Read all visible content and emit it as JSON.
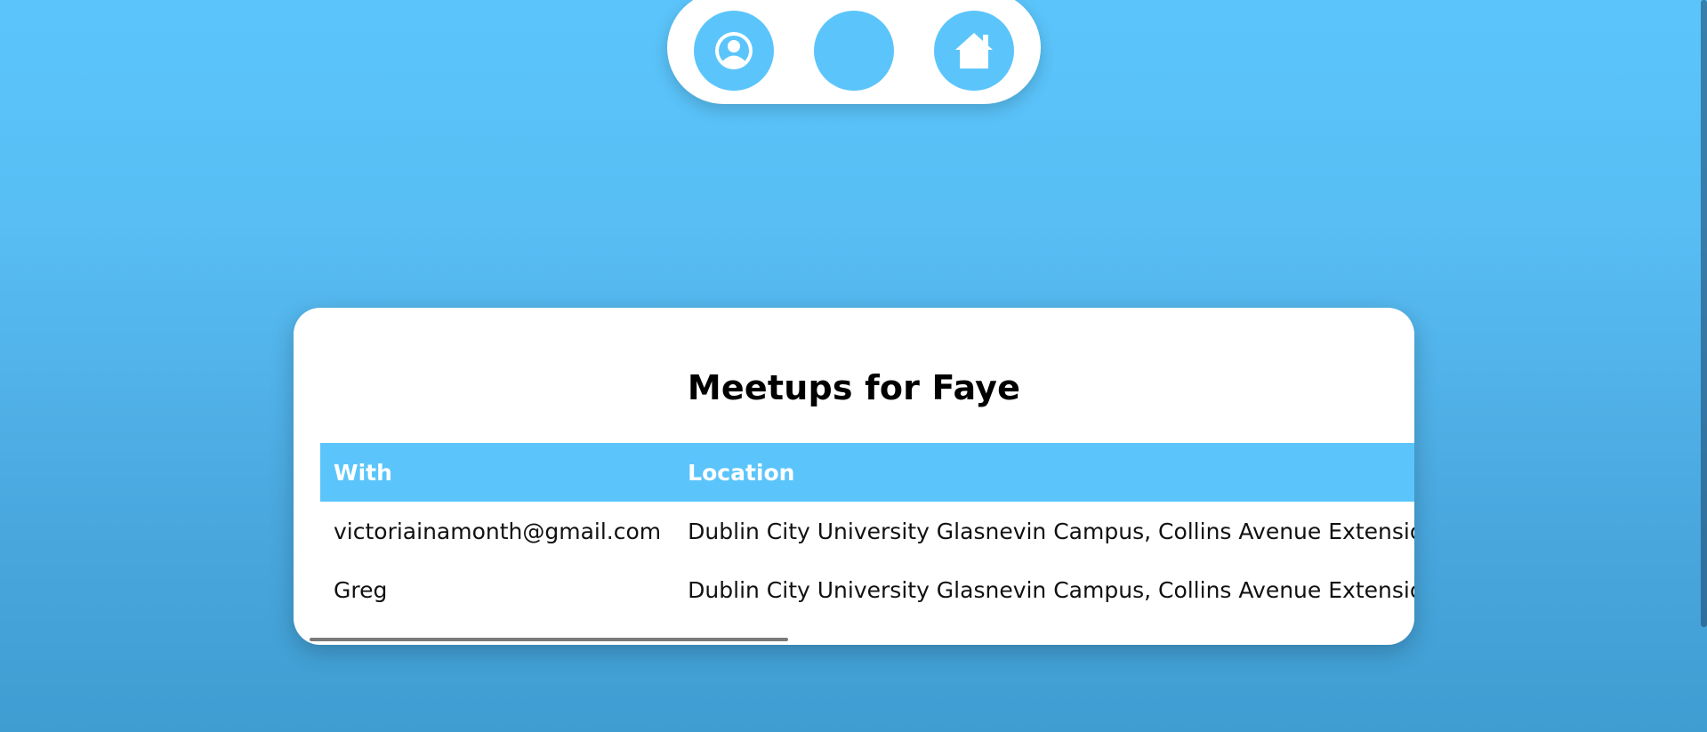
{
  "nav": {
    "buttons": [
      {
        "name": "profile",
        "icon": "user-circle-icon"
      },
      {
        "name": "middle",
        "icon": ""
      },
      {
        "name": "home",
        "icon": "home-icon"
      }
    ]
  },
  "meetups": {
    "title": "Meetups for Faye",
    "columns": [
      "With",
      "Location"
    ],
    "rows": [
      {
        "with": "victoriainamonth@gmail.com",
        "location": "Dublin City University Glasnevin Campus, Collins Avenue Extension, Dr"
      },
      {
        "with": "Greg",
        "location": "Dublin City University Glasnevin Campus, Collins Avenue Extension, Sar"
      }
    ]
  },
  "colors": {
    "accent": "#5bc5fb",
    "background_top": "#5bc5fb",
    "background_bottom": "#3f9dd2"
  }
}
